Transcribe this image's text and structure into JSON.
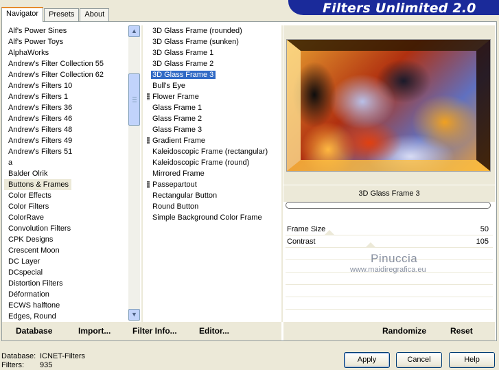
{
  "app": {
    "title": "Filters Unlimited 2.0"
  },
  "tabs": [
    {
      "label": "Navigator",
      "active": true
    },
    {
      "label": "Presets",
      "active": false
    },
    {
      "label": "About",
      "active": false
    }
  ],
  "categories": [
    "Alf's Power Sines",
    "Alf's Power Toys",
    "AlphaWorks",
    "Andrew's Filter Collection 55",
    "Andrew's Filter Collection 62",
    "Andrew's Filters 10",
    "Andrew's Filters 1",
    "Andrew's Filters 36",
    "Andrew's Filters 46",
    "Andrew's Filters 48",
    "Andrew's Filters 49",
    "Andrew's Filters 51",
    "a",
    "Balder Olrik",
    "Buttons & Frames",
    "Color Effects",
    "Color Filters",
    "ColorRave",
    "Convolution Filters",
    "CPK Designs",
    "Crescent Moon",
    "DC Layer",
    "DCspecial",
    "Distortion Filters",
    "Déformation",
    "ECWS halftone",
    "Edges, Round"
  ],
  "selected_category": "Buttons & Frames",
  "filters": [
    {
      "label": "3D Glass Frame (rounded)",
      "sub": false
    },
    {
      "label": "3D Glass Frame (sunken)",
      "sub": false
    },
    {
      "label": "3D Glass Frame 1",
      "sub": false
    },
    {
      "label": "3D Glass Frame 2",
      "sub": false
    },
    {
      "label": "3D Glass Frame 3",
      "sub": false
    },
    {
      "label": "Bull's Eye",
      "sub": false
    },
    {
      "label": "Flower Frame",
      "sub": true
    },
    {
      "label": "Glass Frame 1",
      "sub": false
    },
    {
      "label": "Glass Frame 2",
      "sub": false
    },
    {
      "label": "Glass Frame 3",
      "sub": false
    },
    {
      "label": "Gradient Frame",
      "sub": true
    },
    {
      "label": "Kaleidoscopic Frame (rectangular)",
      "sub": false
    },
    {
      "label": "Kaleidoscopic Frame (round)",
      "sub": false
    },
    {
      "label": "Mirrored Frame",
      "sub": false
    },
    {
      "label": "Passepartout",
      "sub": true
    },
    {
      "label": "Rectangular Button",
      "sub": false
    },
    {
      "label": "Round Button",
      "sub": false
    },
    {
      "label": "Simple Background Color Frame",
      "sub": false
    }
  ],
  "selected_filter": "3D Glass Frame 3",
  "preview": {
    "filter_name": "3D Glass Frame 3"
  },
  "params": [
    {
      "label": "Frame Size",
      "value": "50"
    },
    {
      "label": "Contrast",
      "value": "105"
    }
  ],
  "watermark": {
    "line1": "Pinuccia",
    "line2": "www.maidiregrafica.eu"
  },
  "toolbar_left": {
    "database": "Database",
    "import": "Import...",
    "filter_info": "Filter Info...",
    "editor": "Editor..."
  },
  "toolbar_right": {
    "randomize": "Randomize",
    "reset": "Reset"
  },
  "status": {
    "database_label": "Database:",
    "database_value": "ICNET-Filters",
    "filters_label": "Filters:",
    "filters_value": "935"
  },
  "buttons": {
    "apply": "Apply",
    "cancel": "Cancel",
    "help": "Help"
  }
}
